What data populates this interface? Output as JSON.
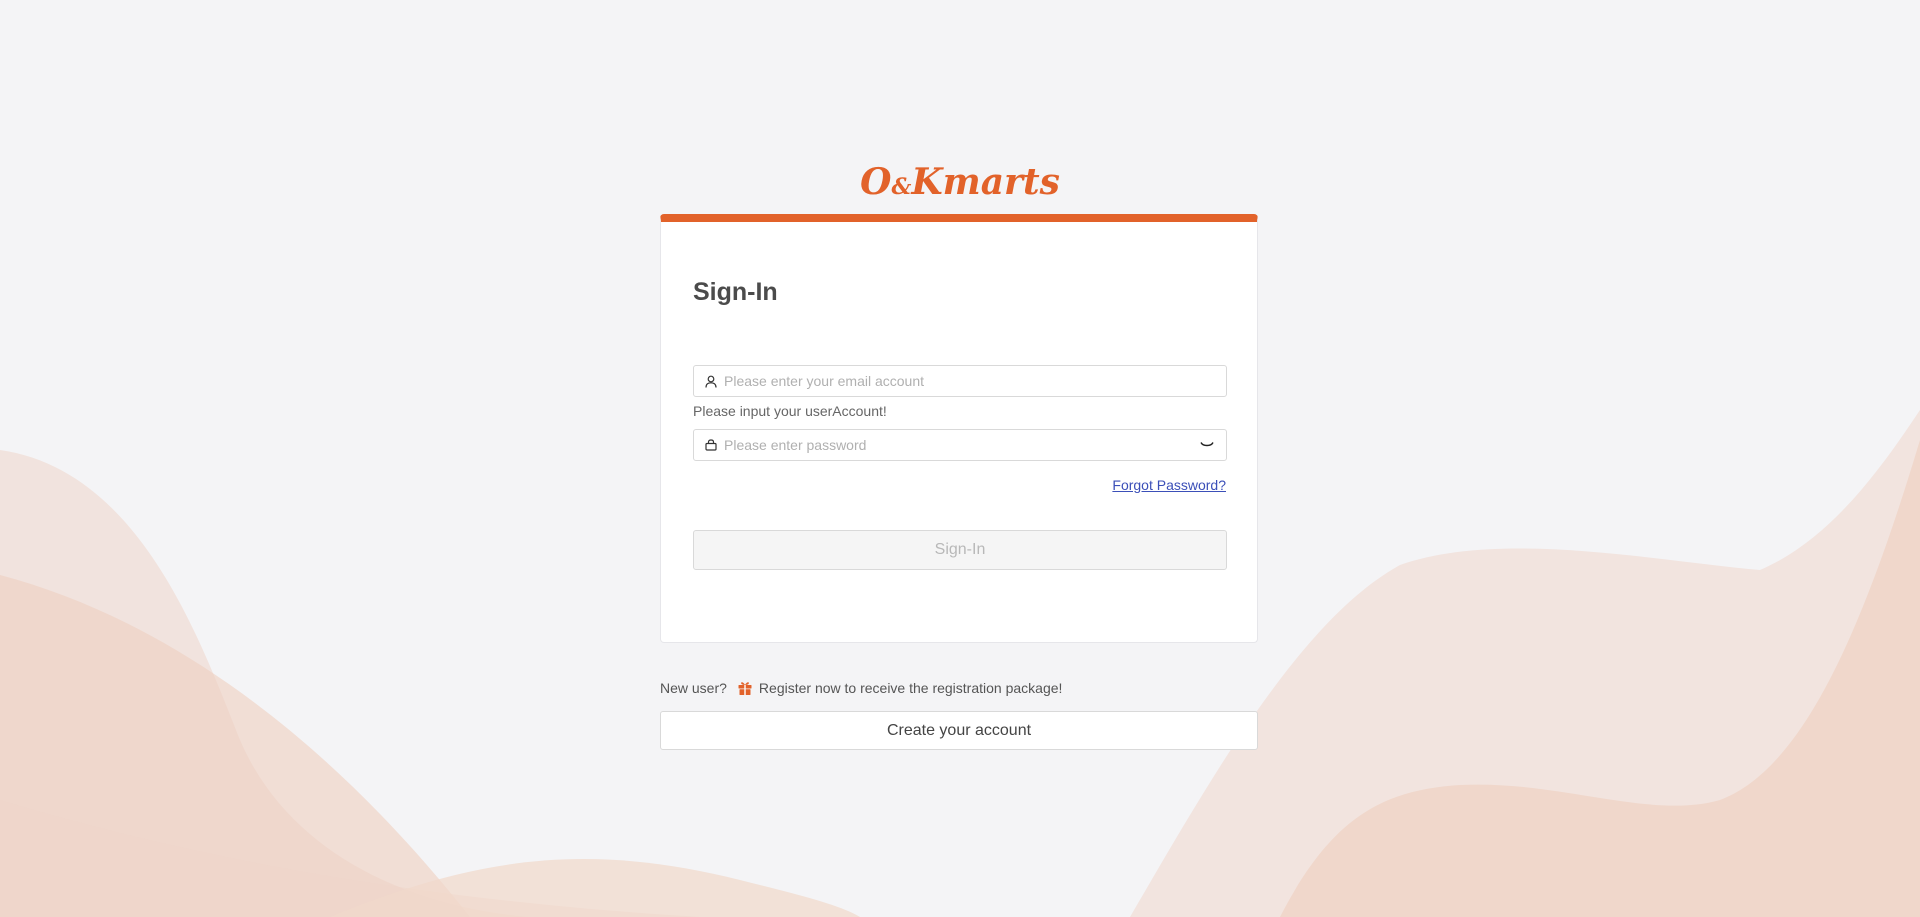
{
  "brand": {
    "logo_main_1": "O",
    "logo_amp": "&",
    "logo_main_2": "Kmarts",
    "accent_color": "#e2622a"
  },
  "signin": {
    "title": "Sign-In",
    "email_placeholder": "Please enter your email account",
    "email_value": "",
    "email_icon": "user-icon",
    "account_hint": "Please input your userAccount!",
    "password_placeholder": "Please enter password",
    "password_value": "",
    "password_icon": "lock-icon",
    "visibility_icon": "eye-closed-icon",
    "forgot_label": "Forgot Password?",
    "submit_label": "Sign-In"
  },
  "register": {
    "prompt": "New user?",
    "gift_icon": "gift-icon",
    "promo": "Register now to receive the registration package!",
    "create_label": "Create your account"
  }
}
